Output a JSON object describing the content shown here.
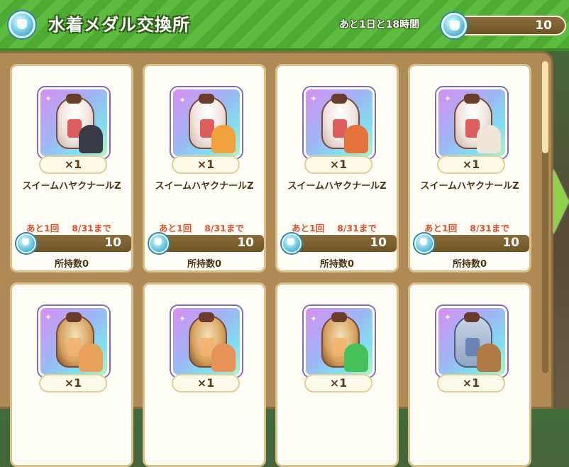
{
  "header": {
    "title": "水着メダル交換所",
    "time_left": "あと1日と18時間",
    "balance": "10",
    "icon": "swimsuit-medal-icon"
  },
  "navigation": {
    "next_icon": "chevron-right-icon"
  },
  "items": [
    {
      "qty": "×1",
      "name": "スイームハヤクナールZ",
      "limit": "あと1回",
      "deadline": "8/31まで",
      "cost": "10",
      "owned": "所持数0",
      "chara_color": "#3b3b48"
    },
    {
      "qty": "×1",
      "name": "スイームハヤクナールZ",
      "limit": "あと1回",
      "deadline": "8/31まで",
      "cost": "10",
      "owned": "所持数0",
      "chara_color": "#f1a23c"
    },
    {
      "qty": "×1",
      "name": "スイームハヤクナールZ",
      "limit": "あと1回",
      "deadline": "8/31まで",
      "cost": "10",
      "owned": "所持数0",
      "chara_color": "#e4733e"
    },
    {
      "qty": "×1",
      "name": "スイームハヤクナールZ",
      "limit": "あと1回",
      "deadline": "8/31まで",
      "cost": "10",
      "owned": "所持数0",
      "chara_color": "#efe6d8"
    },
    {
      "qty": "×1",
      "chara_color": "#e8a15a"
    },
    {
      "qty": "×1",
      "chara_color": "#e8925a"
    },
    {
      "qty": "×1",
      "chara_color": "#47c25a"
    },
    {
      "qty": "×1",
      "chara_color": "#b07a45"
    }
  ]
}
